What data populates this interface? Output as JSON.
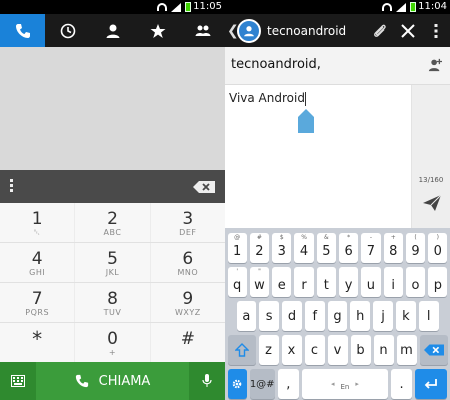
{
  "status_left": {
    "time": "11:05"
  },
  "status_right": {
    "time": "11:04"
  },
  "dialer": {
    "tabs": [
      "phone-icon",
      "recent-icon",
      "contacts-icon",
      "favorites-icon",
      "groups-icon"
    ],
    "keys": [
      [
        {
          "n": "1",
          "l": "␇"
        },
        {
          "n": "2",
          "l": "ABC"
        },
        {
          "n": "3",
          "l": "DEF"
        }
      ],
      [
        {
          "n": "4",
          "l": "GHI"
        },
        {
          "n": "5",
          "l": "JKL"
        },
        {
          "n": "6",
          "l": "MNO"
        }
      ],
      [
        {
          "n": "7",
          "l": "PQRS"
        },
        {
          "n": "8",
          "l": "TUV"
        },
        {
          "n": "9",
          "l": "WXYZ"
        }
      ],
      [
        {
          "n": "*",
          "l": ""
        },
        {
          "n": "0",
          "l": "+"
        },
        {
          "n": "#",
          "l": ""
        }
      ]
    ],
    "voicemail_glyph": "␇",
    "call_label": "CHIAMA"
  },
  "messaging": {
    "contact_name": "tecnoandroid",
    "recipient_value": "tecnoandroid,",
    "message_text": "Viva Android",
    "char_counter": "13/160"
  },
  "keyboard": {
    "row1": [
      {
        "sup": "@",
        "key": "1"
      },
      {
        "sup": "#",
        "key": "2"
      },
      {
        "sup": "$",
        "key": "3"
      },
      {
        "sup": "%",
        "key": "4"
      },
      {
        "sup": "&",
        "key": "5"
      },
      {
        "sup": "*",
        "key": "6"
      },
      {
        "sup": "-",
        "key": "7"
      },
      {
        "sup": "+",
        "key": "8"
      },
      {
        "sup": "(",
        "key": "9"
      },
      {
        "sup": ")",
        "key": "0"
      }
    ],
    "row2": [
      {
        "sup": "'",
        "key": "q"
      },
      {
        "sup": "\"",
        "key": "w"
      },
      {
        "sup": "",
        "key": "e"
      },
      {
        "sup": "",
        "key": "r"
      },
      {
        "sup": "",
        "key": "t"
      },
      {
        "sup": "",
        "key": "y"
      },
      {
        "sup": "",
        "key": "u"
      },
      {
        "sup": "",
        "key": "i"
      },
      {
        "sup": "",
        "key": "o"
      },
      {
        "sup": "",
        "key": "p"
      }
    ],
    "row3": [
      {
        "sup": "",
        "key": "a"
      },
      {
        "sup": "",
        "key": "s"
      },
      {
        "sup": "",
        "key": "d"
      },
      {
        "sup": "",
        "key": "f"
      },
      {
        "sup": "",
        "key": "g"
      },
      {
        "sup": "",
        "key": "h"
      },
      {
        "sup": "",
        "key": "j"
      },
      {
        "sup": "",
        "key": "k"
      },
      {
        "sup": "",
        "key": "l"
      }
    ],
    "row4": [
      {
        "sup": "",
        "key": "z"
      },
      {
        "sup": "",
        "key": "x"
      },
      {
        "sup": "",
        "key": "c"
      },
      {
        "sup": "",
        "key": "v"
      },
      {
        "sup": "",
        "key": "b"
      },
      {
        "sup": "",
        "key": "n"
      },
      {
        "sup": "",
        "key": "m"
      }
    ],
    "symbols_label": "1@#",
    "space_label": "En",
    "comma": ",",
    "period": "."
  },
  "colors": {
    "dialer_active_tab": "#1a82d9",
    "call_green": "#3b9c3b",
    "avatar_blue": "#2f82d0",
    "keyboard_bg": "#c9ced6",
    "key_accent": "#1f8ce8"
  }
}
